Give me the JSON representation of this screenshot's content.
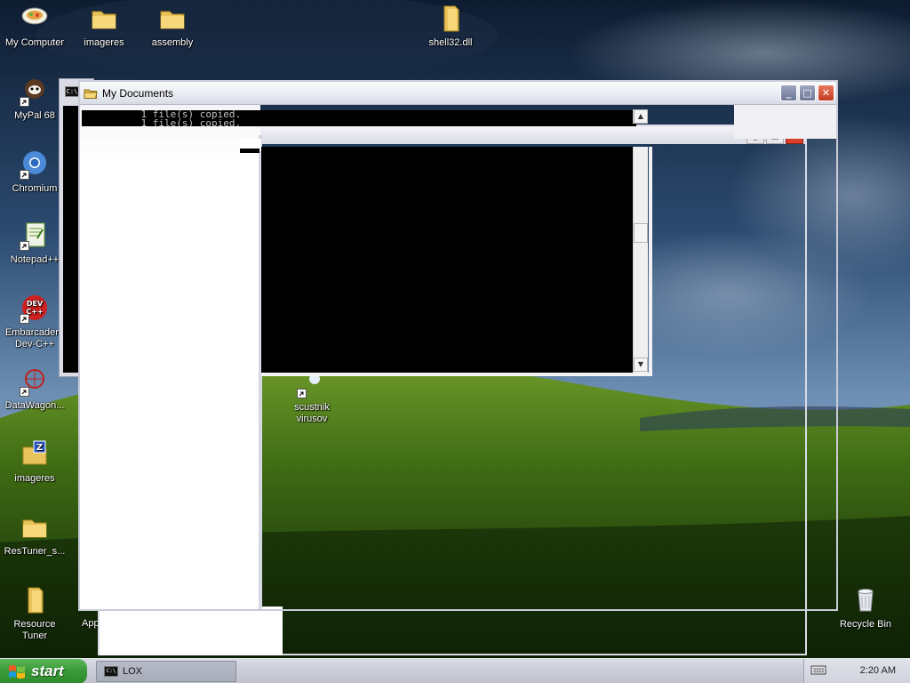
{
  "desktop": {
    "icons": [
      {
        "label": "My Computer"
      },
      {
        "label": "imageres"
      },
      {
        "label": "assembly"
      },
      {
        "label": "shell32.dll"
      },
      {
        "label": "MyPal 68"
      },
      {
        "label": "Chromium"
      },
      {
        "label": "Notepad++"
      },
      {
        "label": "Embarcadero Dev-C++"
      },
      {
        "label": "DataWagon..."
      },
      {
        "label": "scustnik virusov"
      },
      {
        "label": "imageres"
      },
      {
        "label": "ResTuner_s..."
      },
      {
        "label": "Resource Tuner"
      },
      {
        "label": "App"
      },
      {
        "label": "Recycle Bin"
      }
    ]
  },
  "windows": {
    "my_documents": {
      "title": "My Documents",
      "min_label": "_",
      "max_label": "□",
      "close_label": "✕"
    },
    "console": {
      "lines": [
        "    1 file(s) copied.",
        "    1 file(s) copied."
      ],
      "scroll_up": "▲",
      "scroll_down": "▼"
    },
    "cmd_back": {
      "icon_label": "C:\\"
    },
    "ghost": {
      "min_label": "_",
      "max_label": "□",
      "close_label": "✕"
    }
  },
  "taskbar": {
    "start_label": "start",
    "tasks": [
      {
        "label": "LOX",
        "icon_label": "C:\\"
      }
    ],
    "clock": "2:20 AM"
  },
  "colors": {
    "start_green": "#3a9a39",
    "close_red": "#c33a1f",
    "console_bg": "#000000"
  }
}
